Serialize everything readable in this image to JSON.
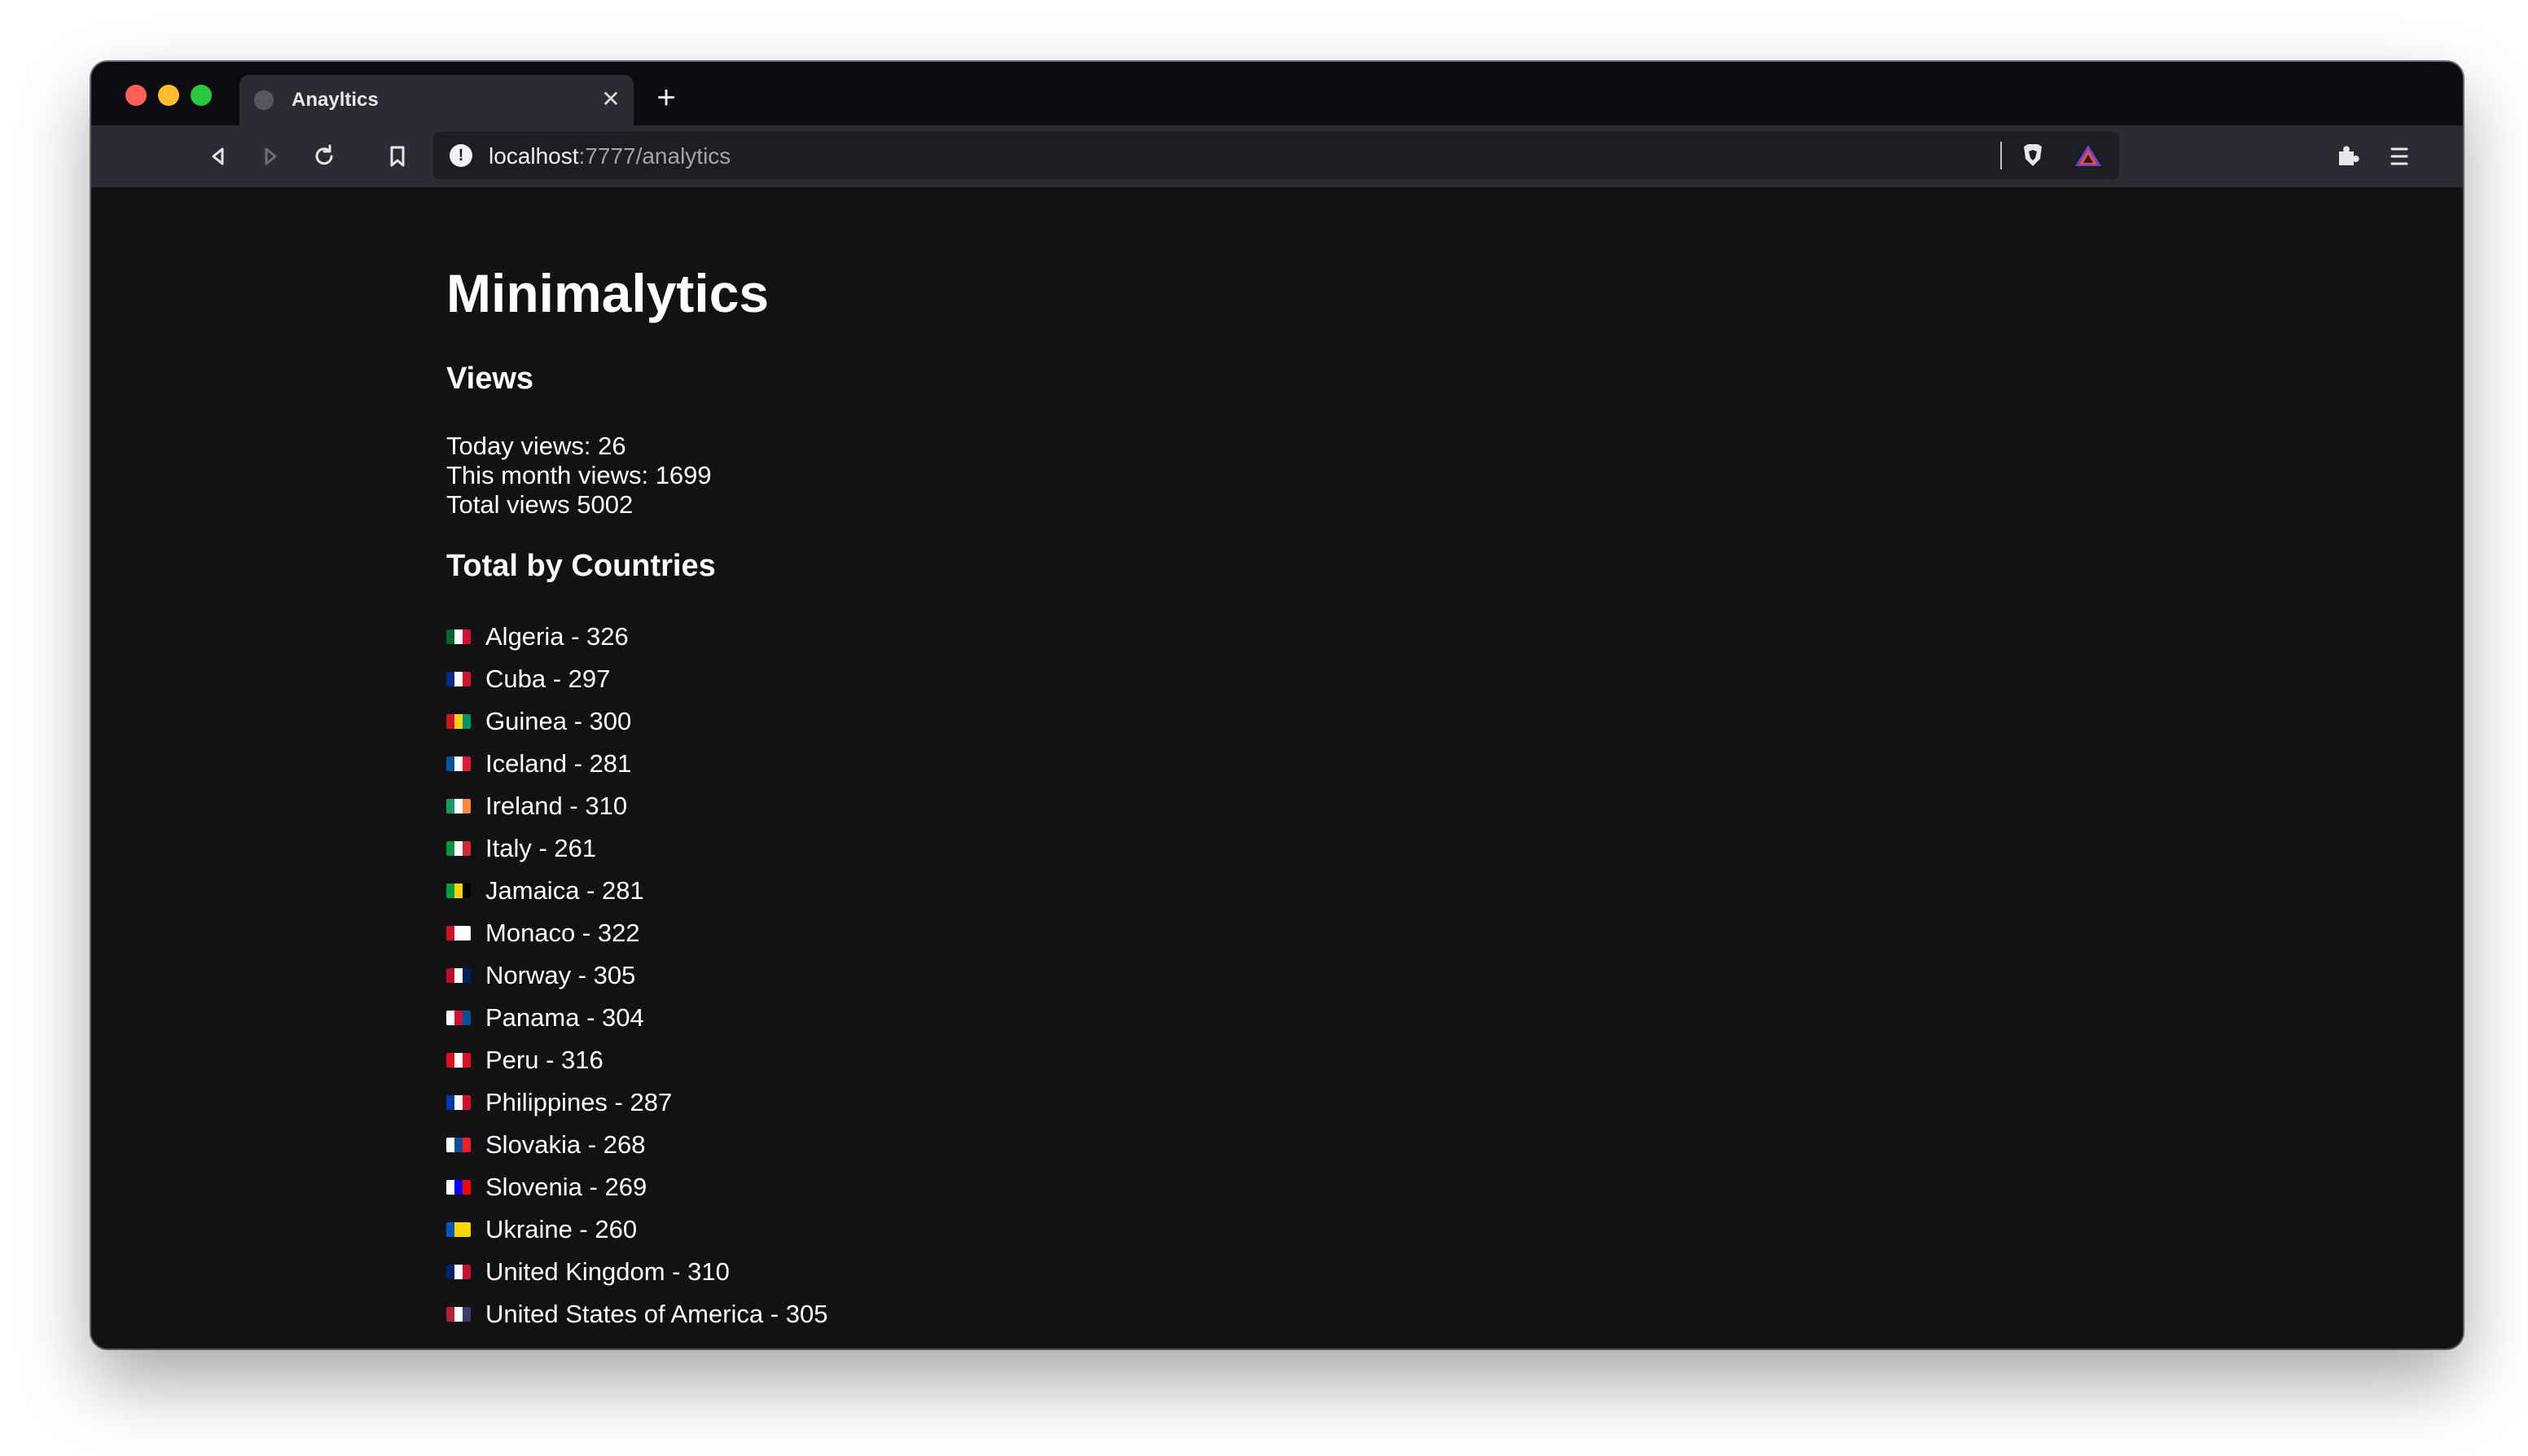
{
  "browser": {
    "tab": {
      "title": "Anayltics",
      "close_icon": "close-icon",
      "favicon": "globe-icon"
    },
    "new_tab_label": "+",
    "address": {
      "host": "localhost",
      "rest": ":7777/analytics",
      "info_icon": "!"
    }
  },
  "page": {
    "title": "Minimalytics",
    "views_heading": "Views",
    "today_views": "Today views: 26",
    "month_views": "This month views: 1699",
    "total_views": "Total views 5002",
    "countries_heading": "Total by Countries",
    "countries": [
      {
        "label": "Algeria - 326",
        "flag": "algeria-flag",
        "colors": [
          "#006233",
          "#ffffff",
          "#d21034"
        ]
      },
      {
        "label": "Cuba - 297",
        "flag": "cuba-flag",
        "colors": [
          "#002a8f",
          "#ffffff",
          "#cf142b"
        ]
      },
      {
        "label": "Guinea - 300",
        "flag": "guinea-flag",
        "colors": [
          "#ce1126",
          "#fcd116",
          "#009460"
        ]
      },
      {
        "label": "Iceland - 281",
        "flag": "iceland-flag",
        "colors": [
          "#02529c",
          "#ffffff",
          "#dc1e35"
        ]
      },
      {
        "label": "Ireland - 310",
        "flag": "ireland-flag",
        "colors": [
          "#169b62",
          "#ffffff",
          "#ff883e"
        ]
      },
      {
        "label": "Italy - 261",
        "flag": "italy-flag",
        "colors": [
          "#009246",
          "#ffffff",
          "#ce2b37"
        ]
      },
      {
        "label": "Jamaica - 281",
        "flag": "jamaica-flag",
        "colors": [
          "#009b3a",
          "#fed100",
          "#000000"
        ]
      },
      {
        "label": "Monaco - 322",
        "flag": "monaco-flag",
        "colors": [
          "#ce1126",
          "#ffffff",
          "#ffffff"
        ]
      },
      {
        "label": "Norway - 305",
        "flag": "norway-flag",
        "colors": [
          "#ba0c2f",
          "#ffffff",
          "#00205b"
        ]
      },
      {
        "label": "Panama - 304",
        "flag": "panama-flag",
        "colors": [
          "#ffffff",
          "#d21034",
          "#005293"
        ]
      },
      {
        "label": "Peru - 316",
        "flag": "peru-flag",
        "colors": [
          "#d91023",
          "#ffffff",
          "#d91023"
        ]
      },
      {
        "label": "Philippines - 287",
        "flag": "philippines-flag",
        "colors": [
          "#0038a8",
          "#ffffff",
          "#ce1126"
        ]
      },
      {
        "label": "Slovakia - 268",
        "flag": "slovakia-flag",
        "colors": [
          "#ffffff",
          "#0b4ea2",
          "#ee1c25"
        ]
      },
      {
        "label": "Slovenia - 269",
        "flag": "slovenia-flag",
        "colors": [
          "#ffffff",
          "#0000ff",
          "#ff0000"
        ]
      },
      {
        "label": "Ukraine - 260",
        "flag": "ukraine-flag",
        "colors": [
          "#0057b7",
          "#ffd700",
          "#ffd700"
        ]
      },
      {
        "label": "United Kingdom - 310",
        "flag": "uk-flag",
        "colors": [
          "#012169",
          "#ffffff",
          "#c8102e"
        ]
      },
      {
        "label": "United States of America - 305",
        "flag": "usa-flag",
        "colors": [
          "#b22234",
          "#ffffff",
          "#3c3b6e"
        ]
      }
    ]
  }
}
